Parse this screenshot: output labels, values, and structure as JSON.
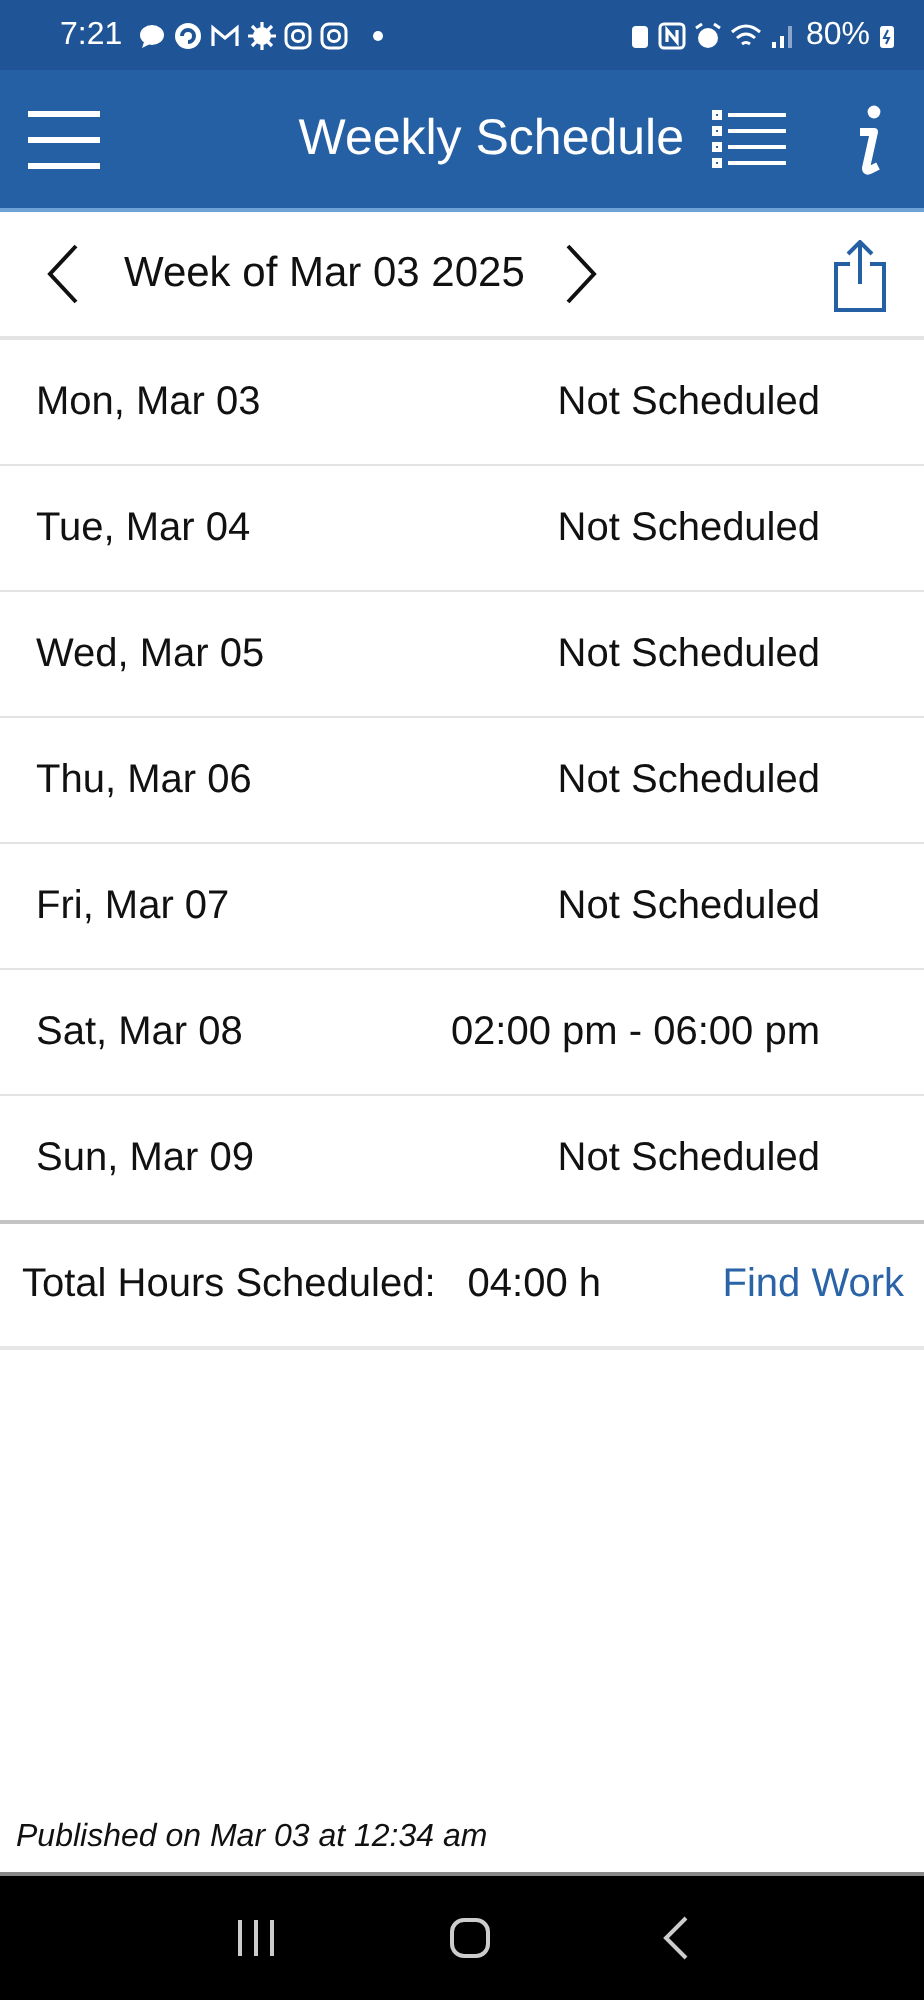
{
  "status_bar": {
    "time": "7:21",
    "battery": "80%"
  },
  "app_bar": {
    "title": "Weekly Schedule"
  },
  "week_nav": {
    "label": "Week of Mar 03 2025"
  },
  "days": [
    {
      "day": "Mon, Mar 03",
      "shift": "Not Scheduled"
    },
    {
      "day": "Tue, Mar 04",
      "shift": "Not Scheduled"
    },
    {
      "day": "Wed, Mar 05",
      "shift": "Not Scheduled"
    },
    {
      "day": "Thu, Mar 06",
      "shift": "Not Scheduled"
    },
    {
      "day": "Fri, Mar 07",
      "shift": "Not Scheduled"
    },
    {
      "day": "Sat, Mar 08",
      "shift": "02:00 pm - 06:00 pm"
    },
    {
      "day": "Sun, Mar 09",
      "shift": "Not Scheduled"
    }
  ],
  "total": {
    "label": "Total Hours Scheduled:",
    "value": "04:00 h",
    "link": "Find Work"
  },
  "footer": {
    "published": "Published on Mar 03 at 12:34 am"
  }
}
